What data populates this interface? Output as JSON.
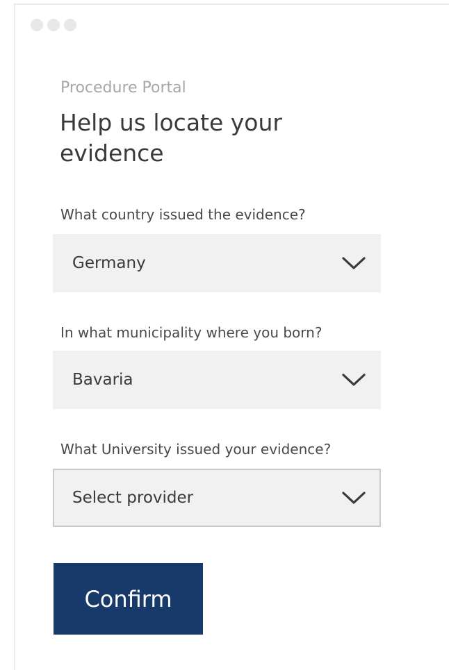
{
  "window": {
    "controls": [
      "dot",
      "dot",
      "dot"
    ]
  },
  "header": {
    "eyebrow": "Procedure Portal",
    "title": "Help us locate your evidence"
  },
  "form": {
    "country": {
      "label": "What country issued the evidence?",
      "value": "Germany",
      "icon": "chevron-down-icon"
    },
    "municipality": {
      "label": "In what municipality where you born?",
      "value": "Bavaria",
      "icon": "chevron-down-icon"
    },
    "university": {
      "label": "What University issued your evidence?",
      "placeholder": "Select provider",
      "icon": "chevron-down-icon"
    },
    "confirm_label": "Confirm"
  },
  "colors": {
    "primary_button": "#173a6a",
    "select_background": "#f1f1f1",
    "muted_text": "#a7a7a7"
  }
}
